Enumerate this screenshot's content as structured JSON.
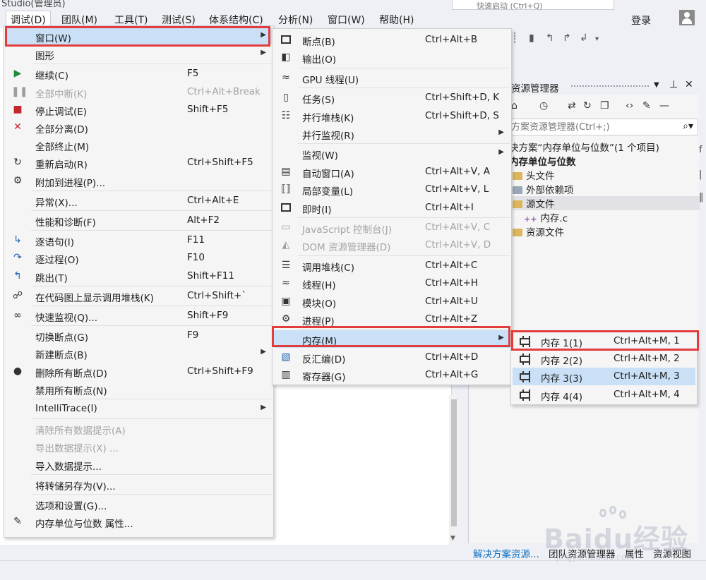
{
  "window": {
    "title_fragment": "Studio(管理员)",
    "quicklaunch_fragment": "快速启动 (Ctrl+Q)"
  },
  "menubar": {
    "items": [
      "调试(D)",
      "团队(M)",
      "工具(T)",
      "测试(S)",
      "体系结构(C)",
      "分析(N)",
      "窗口(W)",
      "帮助(H)"
    ],
    "active": "调试(D)",
    "login": "登录"
  },
  "debug_menu": [
    {
      "label": "窗口(W)",
      "shortcut": "",
      "submenu": true,
      "highlighted": true,
      "icon": ""
    },
    {
      "label": "图形",
      "shortcut": "",
      "submenu": true,
      "icon": ""
    },
    {
      "separator": true
    },
    {
      "label": "继续(C)",
      "shortcut": "F5",
      "icon": "play-icon"
    },
    {
      "label": "全部中断(K)",
      "shortcut": "Ctrl+Alt+Break",
      "disabled": true,
      "icon": "pause-icon"
    },
    {
      "label": "停止调试(E)",
      "shortcut": "Shift+F5",
      "icon": "stop-icon"
    },
    {
      "label": "全部分离(D)",
      "shortcut": "",
      "icon": "detach-icon"
    },
    {
      "label": "全部终止(M)",
      "shortcut": "",
      "icon": ""
    },
    {
      "label": "重新启动(R)",
      "shortcut": "Ctrl+Shift+F5",
      "icon": "restart-icon"
    },
    {
      "label": "附加到进程(P)...",
      "shortcut": "",
      "icon": "attach-icon"
    },
    {
      "separator": true
    },
    {
      "label": "异常(X)...",
      "shortcut": "Ctrl+Alt+E",
      "icon": ""
    },
    {
      "separator": true
    },
    {
      "label": "性能和诊断(F)",
      "shortcut": "Alt+F2",
      "icon": ""
    },
    {
      "separator": true
    },
    {
      "label": "逐语句(I)",
      "shortcut": "F11",
      "icon": "step-into-icon"
    },
    {
      "label": "逐过程(O)",
      "shortcut": "F10",
      "icon": "step-over-icon"
    },
    {
      "label": "跳出(T)",
      "shortcut": "Shift+F11",
      "icon": "step-out-icon"
    },
    {
      "separator": true
    },
    {
      "label": "在代码图上显示调用堆栈(K)",
      "shortcut": "Ctrl+Shift+`",
      "icon": "code-map-icon"
    },
    {
      "separator": true
    },
    {
      "label": "快速监视(Q)...",
      "shortcut": "Shift+F9",
      "icon": "glasses-icon"
    },
    {
      "separator": true
    },
    {
      "label": "切换断点(G)",
      "shortcut": "F9",
      "icon": ""
    },
    {
      "label": "新建断点(B)",
      "shortcut": "",
      "submenu": true,
      "icon": ""
    },
    {
      "label": "删除所有断点(D)",
      "shortcut": "Ctrl+Shift+F9",
      "icon": "delete-breakpoints-icon"
    },
    {
      "label": "禁用所有断点(N)",
      "shortcut": "",
      "icon": ""
    },
    {
      "separator": true
    },
    {
      "label": "IntelliTrace(I)",
      "shortcut": "",
      "submenu": true,
      "icon": ""
    },
    {
      "separator": true
    },
    {
      "label": "清除所有数据提示(A)",
      "shortcut": "",
      "disabled": true,
      "icon": ""
    },
    {
      "label": "导出数据提示(X) ...",
      "shortcut": "",
      "disabled": true,
      "icon": ""
    },
    {
      "label": "导入数据提示...",
      "shortcut": "",
      "icon": ""
    },
    {
      "separator": true
    },
    {
      "label": "将转储另存为(V)...",
      "shortcut": "",
      "icon": ""
    },
    {
      "separator": true
    },
    {
      "label": "选项和设置(G)...",
      "shortcut": "",
      "icon": ""
    },
    {
      "label": "内存单位与位数 属性...",
      "shortcut": "",
      "icon": "wrench-icon"
    }
  ],
  "window_menu": [
    {
      "label": "断点(B)",
      "shortcut": "Ctrl+Alt+B",
      "icon": "breakpoints-icon"
    },
    {
      "label": "输出(O)",
      "shortcut": "",
      "icon": "output-icon"
    },
    {
      "separator": true
    },
    {
      "label": "GPU 线程(U)",
      "shortcut": "",
      "icon": "threads-icon"
    },
    {
      "separator": true
    },
    {
      "label": "任务(S)",
      "shortcut": "Ctrl+Shift+D, K",
      "icon": "tasks-icon"
    },
    {
      "label": "并行堆栈(K)",
      "shortcut": "Ctrl+Shift+D, S",
      "icon": "parallel-stacks-icon"
    },
    {
      "label": "并行监视(R)",
      "shortcut": "",
      "submenu": true,
      "icon": ""
    },
    {
      "separator": true
    },
    {
      "label": "监视(W)",
      "shortcut": "",
      "submenu": true,
      "icon": ""
    },
    {
      "label": "自动窗口(A)",
      "shortcut": "Ctrl+Alt+V, A",
      "icon": "autos-icon"
    },
    {
      "label": "局部变量(L)",
      "shortcut": "Ctrl+Alt+V, L",
      "icon": "locals-icon"
    },
    {
      "label": "即时(I)",
      "shortcut": "Ctrl+Alt+I",
      "icon": "immediate-icon"
    },
    {
      "separator": true
    },
    {
      "label": "JavaScript 控制台(J)",
      "shortcut": "Ctrl+Alt+V, C",
      "disabled": true,
      "icon": "js-console-icon"
    },
    {
      "label": "DOM 资源管理器(D)",
      "shortcut": "Ctrl+Alt+V, D",
      "disabled": true,
      "icon": "dom-explorer-icon"
    },
    {
      "separator": true
    },
    {
      "label": "调用堆栈(C)",
      "shortcut": "Ctrl+Alt+C",
      "icon": "call-stack-icon"
    },
    {
      "label": "线程(H)",
      "shortcut": "Ctrl+Alt+H",
      "icon": "threads-icon"
    },
    {
      "label": "模块(O)",
      "shortcut": "Ctrl+Alt+U",
      "icon": "modules-icon"
    },
    {
      "label": "进程(P)",
      "shortcut": "Ctrl+Alt+Z",
      "icon": "processes-icon"
    },
    {
      "separator": true
    },
    {
      "label": "内存(M)",
      "shortcut": "",
      "submenu": true,
      "highlighted": true,
      "icon": ""
    },
    {
      "label": "反汇编(D)",
      "shortcut": "Ctrl+Alt+D",
      "icon": "disassembly-icon"
    },
    {
      "label": "寄存器(G)",
      "shortcut": "Ctrl+Alt+G",
      "icon": "registers-icon"
    }
  ],
  "memory_menu": [
    {
      "label": "内存 1(1)",
      "shortcut": "Ctrl+Alt+M, 1",
      "icon": "memory-icon"
    },
    {
      "label": "内存 2(2)",
      "shortcut": "Ctrl+Alt+M, 2",
      "icon": "memory-icon"
    },
    {
      "label": "内存 3(3)",
      "shortcut": "Ctrl+Alt+M, 3",
      "icon": "memory-icon",
      "highlighted": true
    },
    {
      "label": "内存 4(4)",
      "shortcut": "Ctrl+Alt+M, 4",
      "icon": "memory-icon"
    }
  ],
  "solution_explorer": {
    "title": "资源管理器",
    "search_placeholder": "方案资源管理器(Ctrl+;)",
    "tree": [
      {
        "label": "决方案“内存单位与位数”(1 个项目)",
        "indent": 0,
        "icon": ""
      },
      {
        "label": "内存单位与位数",
        "indent": 0,
        "bold": true,
        "icon": ""
      },
      {
        "label": "头文件",
        "indent": 1,
        "icon": "folder-icon"
      },
      {
        "label": "外部依赖项",
        "indent": 1,
        "icon": "external-deps-icon"
      },
      {
        "label": "源文件",
        "indent": 1,
        "icon": "folder-icon",
        "selected": true
      },
      {
        "label": "内存.c",
        "indent": 2,
        "icon": "c-file-icon"
      },
      {
        "label": "资源文件",
        "indent": 1,
        "icon": "folder-icon"
      }
    ],
    "tabs": [
      "解决方案资源...",
      "团队资源管理器",
      "属性",
      "资源视图"
    ]
  },
  "watermark": {
    "brand": "Baidu经验",
    "url": "jingyan.baidu.com"
  },
  "colors": {
    "highlight": "#c9e0f7",
    "callout_red": "#e23c3c",
    "menu_bg": "#f5f5f5",
    "link_blue": "#0e70c0"
  }
}
